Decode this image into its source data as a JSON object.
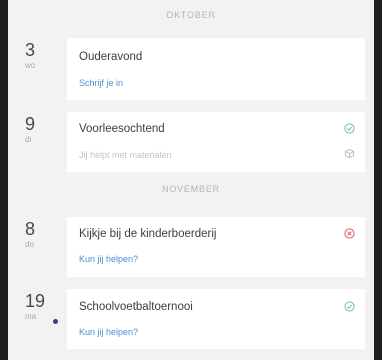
{
  "months": {
    "oct": "OKTOBER",
    "nov": "NOVEMBER"
  },
  "events": [
    {
      "day": "3",
      "weekday": "wo",
      "title": "Ouderavond",
      "sub": "Schrijf je in"
    },
    {
      "day": "9",
      "weekday": "di",
      "title": "Voorleesochtend",
      "sub": "Jij helpt met materialen",
      "icon": "check-circle-icon",
      "icon2": "package-icon"
    },
    {
      "day": "8",
      "weekday": "do",
      "title": "Kijkje bij de kinderboerderij",
      "sub": "Kun jij helpen?",
      "icon": "close-circle-icon"
    },
    {
      "day": "19",
      "weekday": "ma",
      "title": "Schoolvoetbaltoernooi",
      "sub": "Kun jij helpen?",
      "icon": "check-circle-icon"
    }
  ],
  "colors": {
    "accent": "#4a8fd6",
    "check": "#6cc39a",
    "decline": "#e25b6b",
    "dot": "#3b3b8a"
  }
}
